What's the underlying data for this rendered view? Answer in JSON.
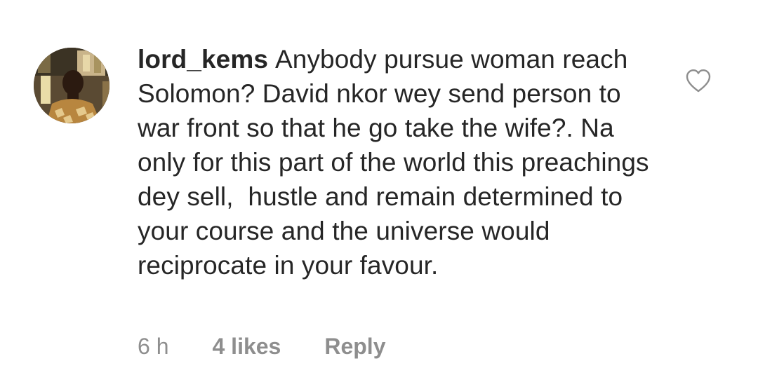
{
  "comment": {
    "username": "lord_kems",
    "text": "Anybody pursue woman reach Solomon? David nkor wey send person to war front so that he go take the wife?. Na only for this part of the world this preachings dey sell,  hustle and remain determined to your course and the universe would reciprocate in your favour.",
    "time": "6 h",
    "likes": "4 likes",
    "reply_label": "Reply",
    "like_icon": "heart-outline-icon"
  },
  "colors": {
    "text": "#262626",
    "meta": "#8e8e8e",
    "background": "#ffffff"
  }
}
